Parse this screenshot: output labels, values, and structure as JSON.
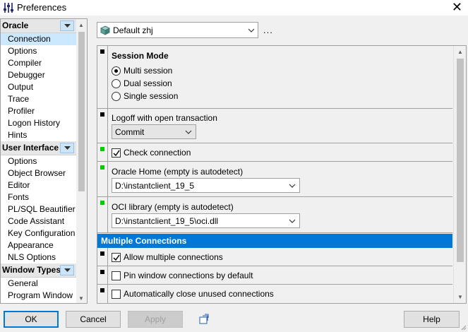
{
  "window": {
    "title": "Preferences",
    "close_glyph": "✕"
  },
  "tree": {
    "groups": [
      {
        "label": "Oracle",
        "items": [
          "Connection",
          "Options",
          "Compiler",
          "Debugger",
          "Output",
          "Trace",
          "Profiler",
          "Logon History",
          "Hints"
        ]
      },
      {
        "label": "User Interface",
        "items": [
          "Options",
          "Object Browser",
          "Editor",
          "Fonts",
          "PL/SQL Beautifier",
          "Code Assistant",
          "Key Configuration",
          "Appearance",
          "NLS Options"
        ]
      },
      {
        "label": "Window Types",
        "items": [
          "General",
          "Program Window"
        ]
      }
    ],
    "selected": "Connection"
  },
  "profile": {
    "value": "Default zhj",
    "more_label": "..."
  },
  "session_mode": {
    "title": "Session Mode",
    "options": [
      "Multi session",
      "Dual session",
      "Single session"
    ],
    "selected": "Multi session"
  },
  "logoff": {
    "label": "Logoff with open transaction",
    "value": "Commit"
  },
  "check_connection": {
    "label": "Check connection",
    "checked": true
  },
  "oracle_home": {
    "label": "Oracle Home (empty is autodetect)",
    "value": "D:\\instantclient_19_5"
  },
  "oci_library": {
    "label": "OCI library (empty is autodetect)",
    "value": "D:\\instantclient_19_5\\oci.dll"
  },
  "multiple_connections": {
    "header": "Multiple Connections",
    "allow": {
      "label": "Allow multiple connections",
      "checked": true
    },
    "pin": {
      "label": "Pin window connections by default",
      "checked": false
    },
    "auto_close": {
      "label": "Automatically close unused connections",
      "checked": false
    }
  },
  "buttons": {
    "ok": "OK",
    "cancel": "Cancel",
    "apply": "Apply",
    "help": "Help"
  },
  "colors": {
    "accent": "#0078d7",
    "selection": "#cce8ff",
    "marker_green": "#00cc00"
  }
}
